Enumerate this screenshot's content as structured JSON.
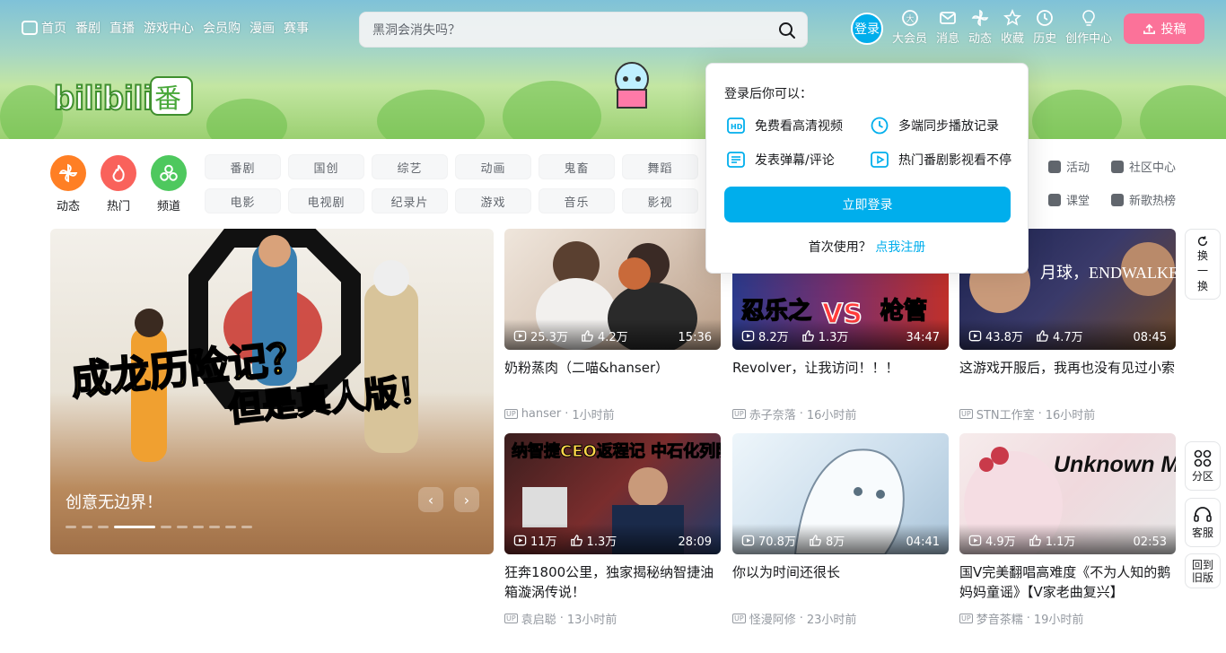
{
  "nav": {
    "items": [
      "首页",
      "番剧",
      "直播",
      "游戏中心",
      "会员购",
      "漫画",
      "赛事"
    ]
  },
  "search": {
    "placeholder": "黑洞会消失吗？"
  },
  "login_label": "登录",
  "right_entries": [
    {
      "label": "大会员",
      "icon": "vip-icon"
    },
    {
      "label": "消息",
      "icon": "mail-icon"
    },
    {
      "label": "动态",
      "icon": "windmill-icon"
    },
    {
      "label": "收藏",
      "icon": "star-icon"
    },
    {
      "label": "历史",
      "icon": "clock-icon"
    },
    {
      "label": "创作中心",
      "icon": "bulb-icon"
    }
  ],
  "upload_label": "投稿",
  "channels": {
    "circles": [
      {
        "label": "动态",
        "color": "#ff7f24"
      },
      {
        "label": "热门",
        "color": "#f9625b"
      },
      {
        "label": "频道",
        "color": "#4ec85e"
      }
    ],
    "chips": [
      "番剧",
      "国创",
      "综艺",
      "动画",
      "鬼畜",
      "舞蹈",
      "电影",
      "电视剧",
      "纪录片",
      "游戏",
      "音乐",
      "影视"
    ],
    "side_links": [
      "活动",
      "社区中心",
      "课堂",
      "新歌热榜"
    ]
  },
  "carousel": {
    "title": "创意无边界！",
    "dots_total": 10,
    "active_dot": 4
  },
  "videos": [
    {
      "views": "25.3万",
      "likes": "4.2万",
      "duration": "15:36",
      "title": "奶粉蒸肉（二喵&hanser）",
      "up": "hanser",
      "time": "1小时前"
    },
    {
      "views": "8.2万",
      "likes": "1.3万",
      "duration": "34:47",
      "title": "Revolver，让我访问！！！",
      "up": "赤子奈落",
      "time": "16小时前"
    },
    {
      "views": "43.8万",
      "likes": "4.7万",
      "duration": "08:45",
      "title": "这游戏开服后，我再也没有见过小索",
      "up": "STN工作室",
      "time": "16小时前"
    },
    {
      "views": "11万",
      "likes": "1.3万",
      "duration": "28:09",
      "title": "狂奔1800公里，独家揭秘纳智捷油箱漩涡传说！",
      "up": "袁启聪",
      "time": "13小时前"
    },
    {
      "views": "70.8万",
      "likes": "8万",
      "duration": "04:41",
      "title": "你以为时间还很长",
      "up": "怪漫阿修",
      "time": "23小时前"
    },
    {
      "views": "4.9万",
      "likes": "1.1万",
      "duration": "02:53",
      "title": "国V完美翻唱高难度《不为人知的鹅妈妈童谣》【V家老曲复兴】",
      "up": "梦音茶糯",
      "time": "19小时前"
    }
  ],
  "thumb_text": {
    "v3": "月球，ENDWALKER 捉拿小索！",
    "v4": "纳智捷CEO返程记 中石化列队欢迎",
    "v6": "Unknown Mother Goose",
    "banner_line1": "成龙历险记？",
    "banner_line2": "但是真人版！",
    "v2_left": "忍乐之",
    "v2_mid": "VS",
    "v2_right": "枪管"
  },
  "popover": {
    "title": "登录后你可以：",
    "items": [
      "免费看高清视频",
      "多端同步播放记录",
      "发表弹幕/评论",
      "热门番剧影视看不停"
    ],
    "button": "立即登录",
    "first_use": "首次使用？",
    "register_link": "点我注册"
  },
  "side_tools": {
    "refresh": "换一换",
    "refresh_chars": [
      "换",
      "一",
      "换"
    ],
    "category": "分区",
    "service": "客服",
    "old_version": "回到旧版"
  },
  "colors": {
    "accent": "#00aeec",
    "pink": "#fb7299"
  }
}
